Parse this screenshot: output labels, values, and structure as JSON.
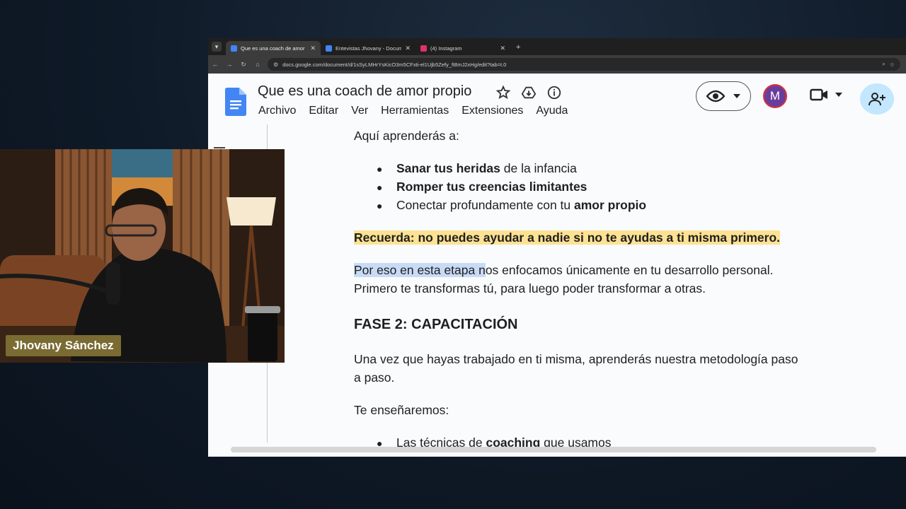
{
  "tabs": [
    {
      "title": "Que es una coach de amor pro",
      "favicon_color": "#4285f4",
      "active": true
    },
    {
      "title": "Entevistas Jhovany - Document",
      "favicon_color": "#4285f4",
      "active": false
    },
    {
      "title": "(4) Instagram",
      "favicon_color": "#e1306c",
      "active": false
    }
  ],
  "address": {
    "url": "docs.google.com/document/d/1sSyLMHrYsKicO3m5CFxti-el1Ujb5Zefy_ft8mJ2xHg/edit?tab=t.0"
  },
  "doc": {
    "title": "Que es una coach de amor propio",
    "menu": [
      "Archivo",
      "Editar",
      "Ver",
      "Herramientas",
      "Extensiones",
      "Ayuda"
    ],
    "avatar_letter": "M"
  },
  "content": {
    "intro": "Aquí aprenderás a:",
    "b1_bold": "Sanar tus heridas",
    "b1_rest": " de la infancia",
    "b2_bold": "Romper tus creencias limitantes",
    "b3_rest": "Conectar profundamente con tu ",
    "b3_bold": "amor propio",
    "reminder": "Recuerda: no puedes ayudar a nadie si no te ayudas a ti misma primero.",
    "p1_selected": "Por eso en esta etapa n",
    "p1_rest": "os enfocamos únicamente en tu desarrollo personal.",
    "p2": "Primero te transformas tú, para luego poder transformar a otras.",
    "heading": "FASE 2: CAPACITACIÓN",
    "p3a": "Una vez que hayas trabajado en ti misma, aprenderás nuestra metodología paso",
    "p3b": "a paso.",
    "p4": "Te enseñaremos:",
    "b4_rest": "Las técnicas de ",
    "b4_bold": "coaching",
    "b4_tail": " que usamos"
  },
  "overlay": {
    "name": "Jhovany Sánchez"
  },
  "colors": {
    "highlight": "#fde293",
    "selection": "#c8dbf6",
    "docs_blue": "#4285f4"
  }
}
